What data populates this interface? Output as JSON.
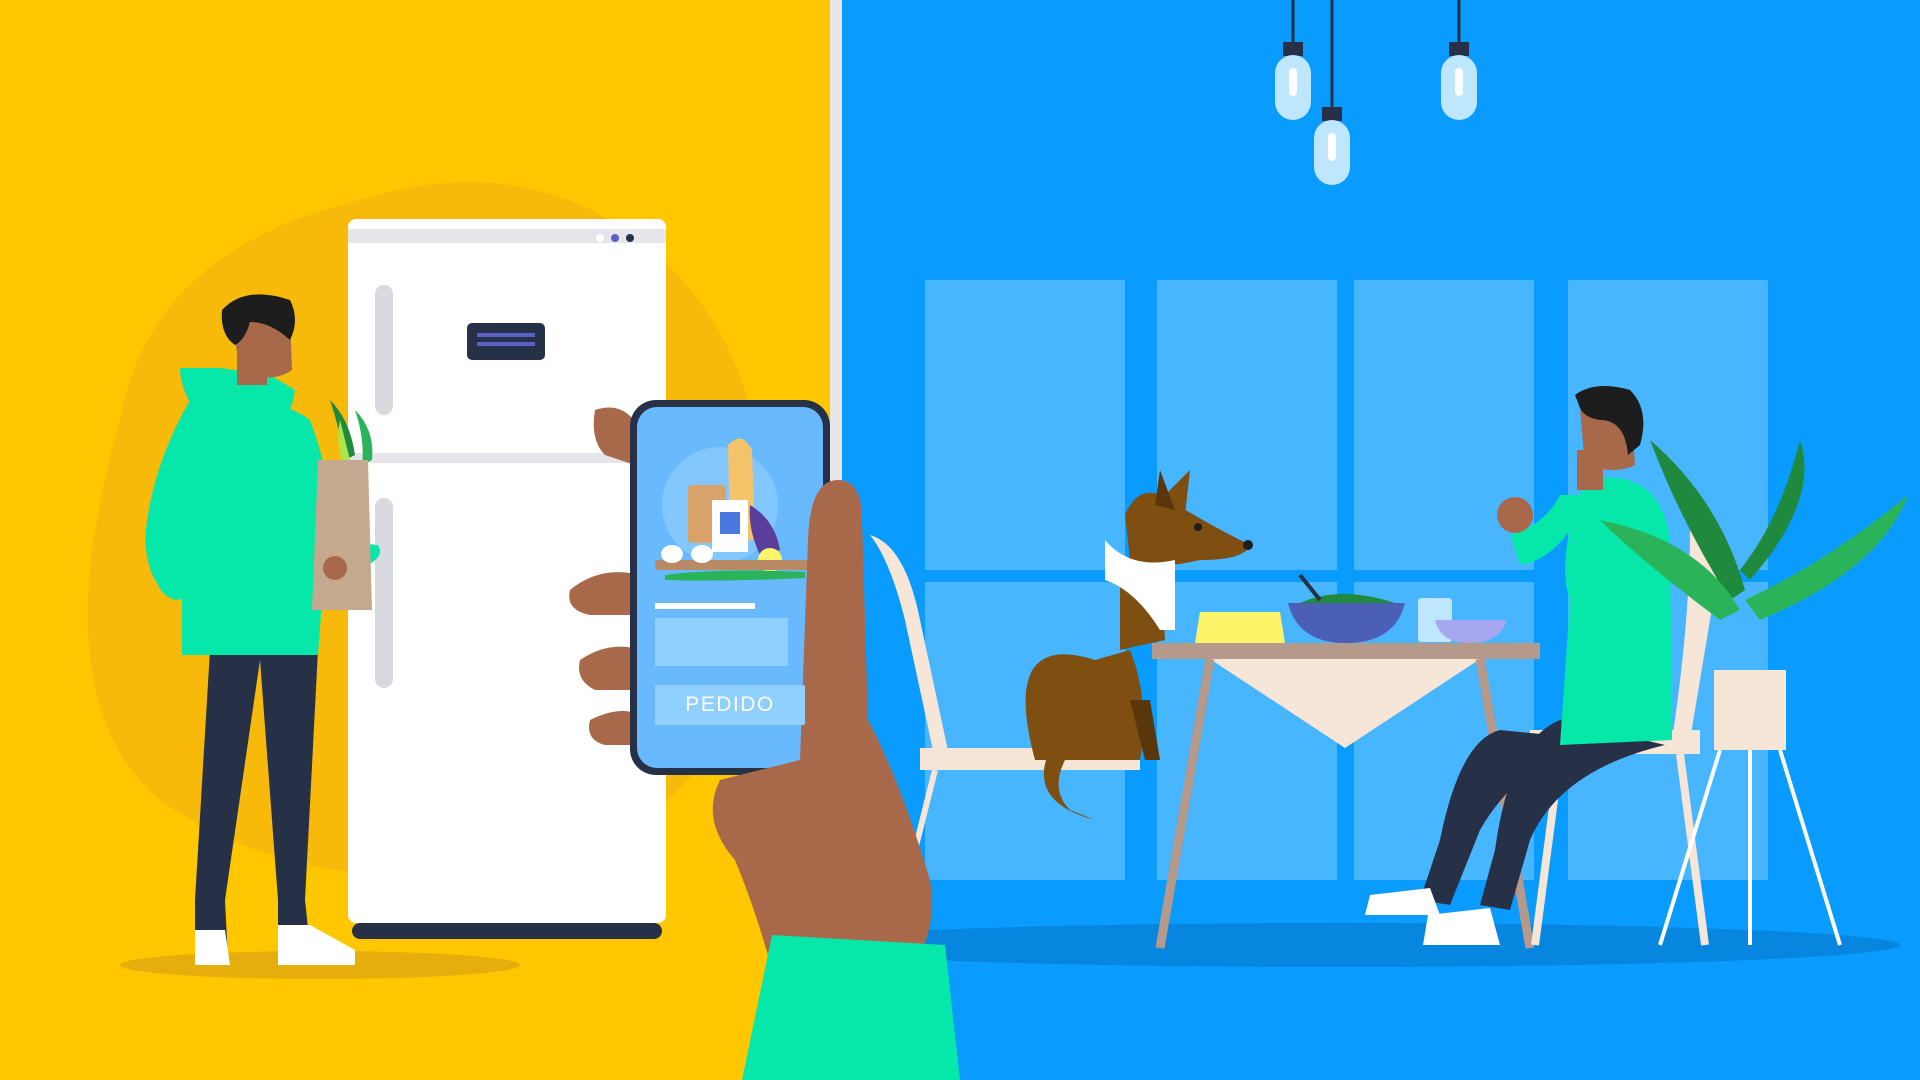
{
  "phone": {
    "order_button_label": "PEDIDO"
  },
  "colors": {
    "left_background": "#ffc700",
    "right_background": "#0a9bff",
    "window_pane": "#48b5ff",
    "hoodie": "#06e8a9",
    "skin": "#a8694a",
    "pants": "#263148",
    "dog": "#7e4f10",
    "refrigerator": "#ffffff"
  },
  "icons": {
    "pendant_lamp": "pendant-lamp-icon",
    "fridge_display": "fridge-display-icon",
    "grocery_bag": "grocery-bag-icon",
    "plant": "potted-plant-icon"
  }
}
